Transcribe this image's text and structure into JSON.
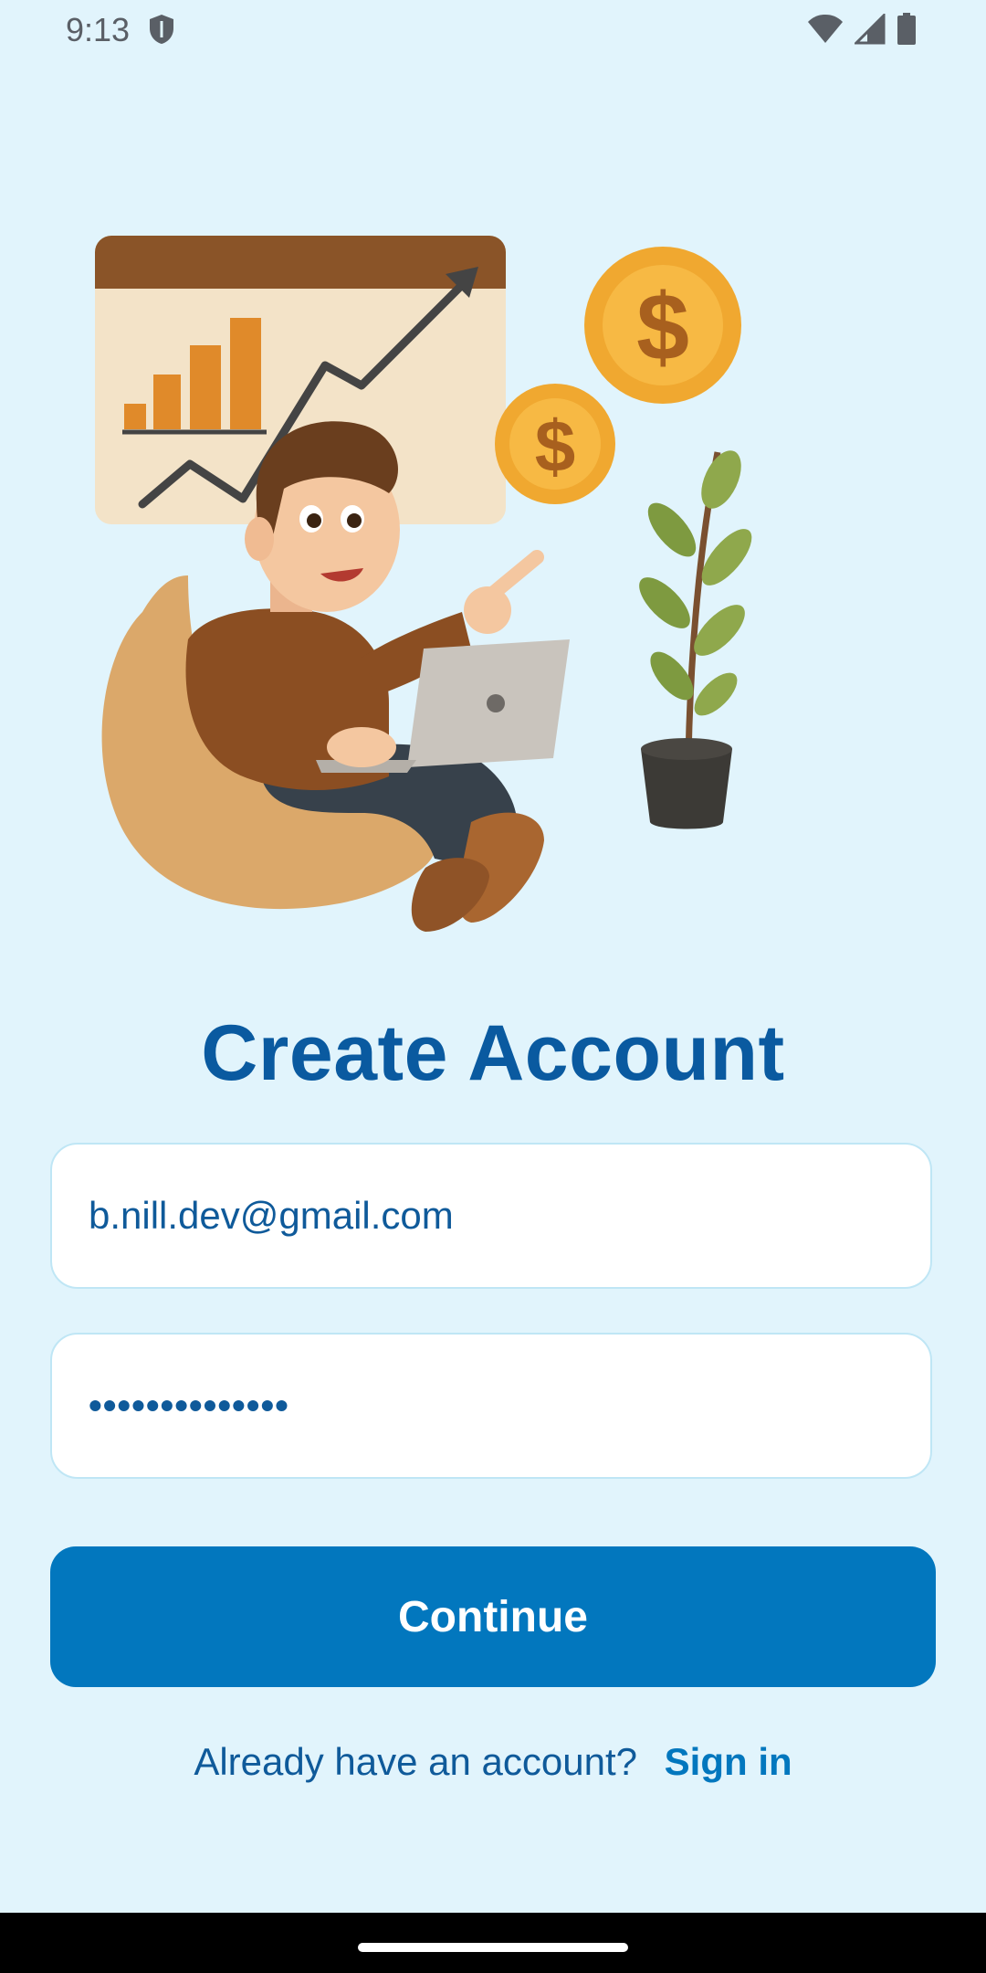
{
  "status_bar": {
    "time": "9:13"
  },
  "illustration": {
    "coin_symbol": "$"
  },
  "title": "Create Account",
  "form": {
    "email_value": "b.nill.dev@gmail.com",
    "password_mask": "••••••••••••••"
  },
  "continue_button": {
    "label": "Continue"
  },
  "signin": {
    "prompt": "Already have an account?",
    "link": "Sign in"
  },
  "colors": {
    "background": "#E1F4FC",
    "title": "#0A5AA0",
    "button": "#0277BE",
    "field_border": "#BFE6F5"
  }
}
